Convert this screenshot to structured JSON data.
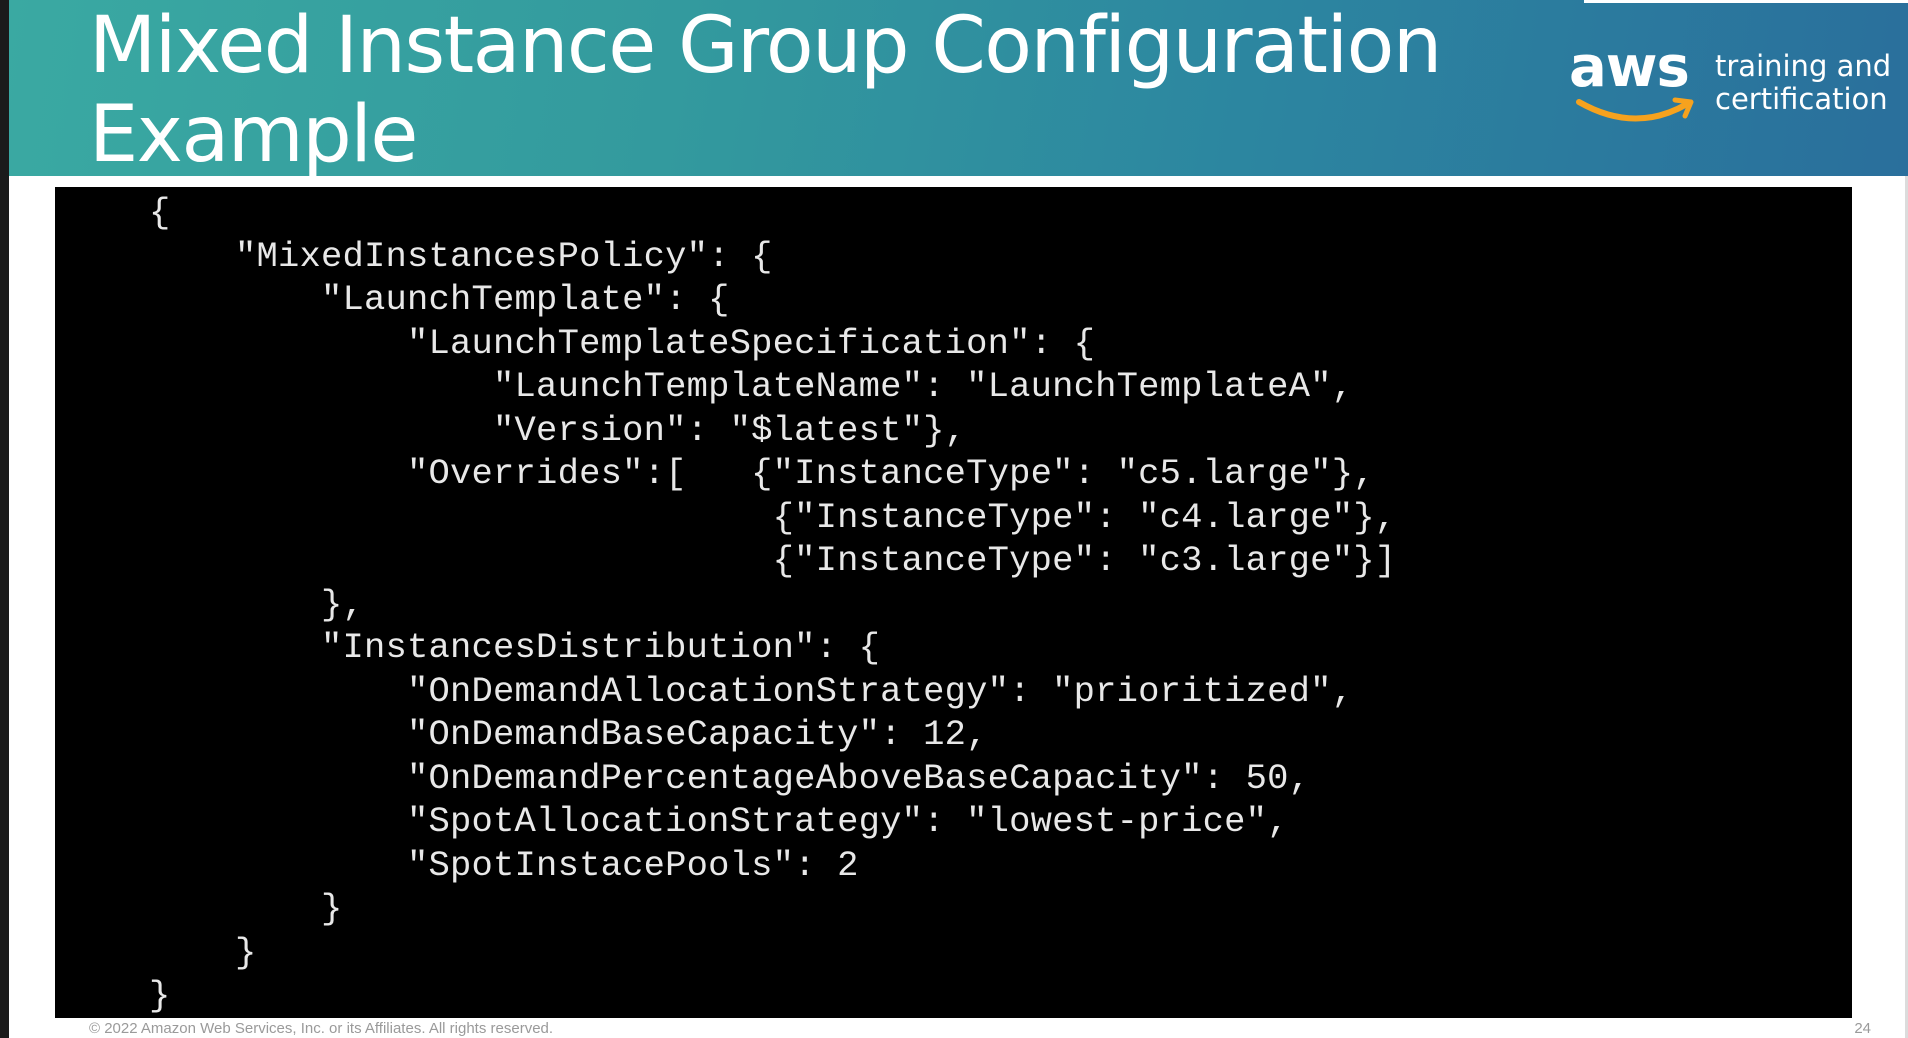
{
  "header": {
    "title_line1": "Mixed Instance Group Configuration",
    "title_line2": "Example",
    "brand": {
      "logo_text": "aws",
      "tagline_line1": "training and",
      "tagline_line2": "certification",
      "logo_icon": "amazon-smile-arrow",
      "smile_color": "#f6a21e"
    },
    "gradient_colors": [
      "#3aa9a2",
      "#2a6f9c"
    ]
  },
  "code": {
    "lines": [
      "{",
      "    \"MixedInstancesPolicy\": {",
      "        \"LaunchTemplate\": {",
      "            \"LaunchTemplateSpecification\": {",
      "                \"LaunchTemplateName\": \"LaunchTemplateA\",",
      "                \"Version\": \"$latest\"},",
      "            \"Overrides\":[   {\"InstanceType\": \"c5.large\"},",
      "                             {\"InstanceType\": \"c4.large\"},",
      "                             {\"InstanceType\": \"c3.large\"}]",
      "        },",
      "        \"InstancesDistribution\": {",
      "            \"OnDemandAllocationStrategy\": \"prioritized\",",
      "            \"OnDemandBaseCapacity\": 12,",
      "            \"OnDemandPercentageAboveBaseCapacity\": 50,",
      "            \"SpotAllocationStrategy\": \"lowest-price\",",
      "            \"SpotInstacePools\": 2",
      "        }",
      "    }",
      "}"
    ]
  },
  "footer": {
    "copyright": "© 2022 Amazon Web Services, Inc. or its Affiliates. All rights reserved.",
    "slide_number": "24"
  }
}
